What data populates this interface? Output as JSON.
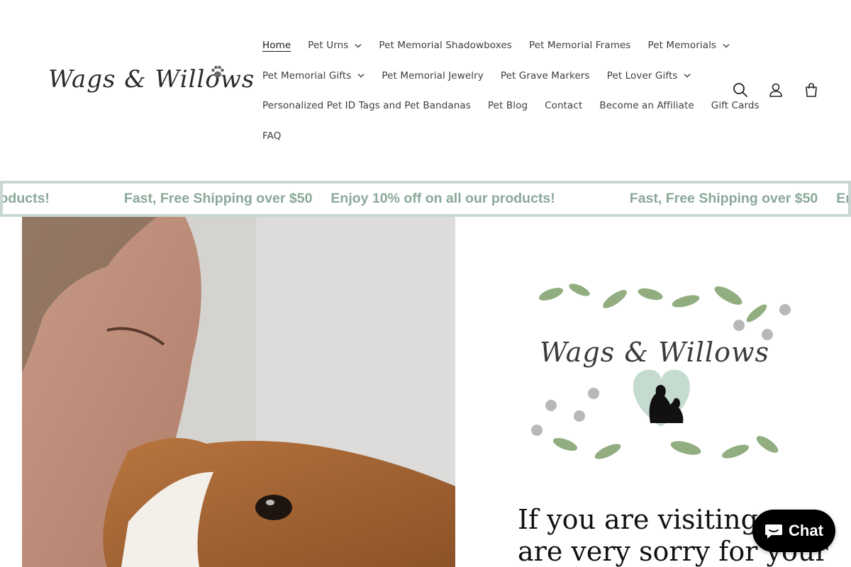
{
  "brand": {
    "name": "Wags & Willows",
    "paw_icon": "paw-icon"
  },
  "nav": {
    "rows": [
      [
        {
          "label": "Home",
          "active": true,
          "dropdown": false
        },
        {
          "label": "Pet Urns",
          "dropdown": true
        },
        {
          "label": "Pet Memorial Shadowboxes",
          "dropdown": false
        },
        {
          "label": "Pet Memorial Frames",
          "dropdown": false
        },
        {
          "label": "Pet Memorials",
          "dropdown": true
        }
      ],
      [
        {
          "label": "Pet Memorial Gifts",
          "dropdown": true
        },
        {
          "label": "Pet Memorial Jewelry",
          "dropdown": false
        },
        {
          "label": "Pet Grave Markers",
          "dropdown": false
        },
        {
          "label": "Pet Lover Gifts",
          "dropdown": true
        }
      ],
      [
        {
          "label": "Personalized Pet ID Tags and Pet Bandanas",
          "dropdown": false
        },
        {
          "label": "Pet Blog",
          "dropdown": false
        },
        {
          "label": "Contact",
          "dropdown": false
        },
        {
          "label": "Become an Affiliate",
          "dropdown": false
        },
        {
          "label": "Gift Cards",
          "dropdown": false
        }
      ],
      [
        {
          "label": "FAQ",
          "dropdown": false
        }
      ]
    ]
  },
  "header_icons": [
    "search-icon",
    "account-icon",
    "cart-icon"
  ],
  "announcement": {
    "messages": [
      "products!",
      "Fast, Free Shipping over $50",
      "Enjoy 10% off on all our products!",
      "Fast, Free Shipping over $50",
      "Enjoy"
    ]
  },
  "hero": {
    "card_logo": "Wags & Willows",
    "visit_lines": [
      "If you are visiting, we",
      "are very sorry for your"
    ]
  },
  "chat": {
    "label": "Chat"
  },
  "colors": {
    "accent_green": "#8aa898",
    "announce_border": "#c8d8d1",
    "heart": "#c5dbd0"
  }
}
